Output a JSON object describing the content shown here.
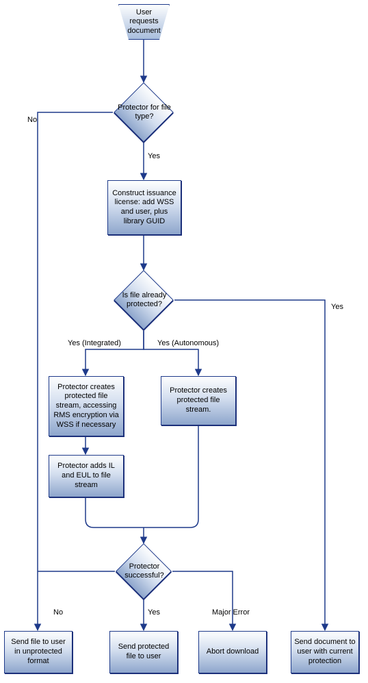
{
  "colors": {
    "stroke": "#1e3a8a",
    "shadow": "#1b2f7a",
    "fill_top": "#fdfefe",
    "fill_bot": "#8ea6cc"
  },
  "start": {
    "label": "User\nrequests\ndocument"
  },
  "decisions": {
    "protector_for_filetype": {
      "label": "Protector for file type?"
    },
    "file_already_protected": {
      "label": "Is file already protected?"
    },
    "protector_successful": {
      "label": "Protector successful?"
    }
  },
  "processes": {
    "construct_license": {
      "label": "Construct issuance license:\nadd WSS and user, plus library GUID"
    },
    "integrated_stream": {
      "label": "Protector creates protected file stream, accessing RMS encryption via WSS if necessary"
    },
    "autonomous_stream": {
      "label": "Protector creates protected file stream."
    },
    "add_il_eul": {
      "label": "Protector adds IL and EUL to file stream"
    }
  },
  "terminals": {
    "send_unprotected": {
      "label": "Send file to user in unprotected format"
    },
    "send_protected": {
      "label": "Send protected file to user"
    },
    "abort_download": {
      "label": "Abort download"
    },
    "send_current_protect": {
      "label": "Send document to user with current protection"
    }
  },
  "edges": {
    "yes": "Yes",
    "no": "No",
    "yes_integrated": "Yes (Integrated)",
    "yes_autonomous": "Yes (Autonomous)",
    "major_error": "Major Error"
  }
}
